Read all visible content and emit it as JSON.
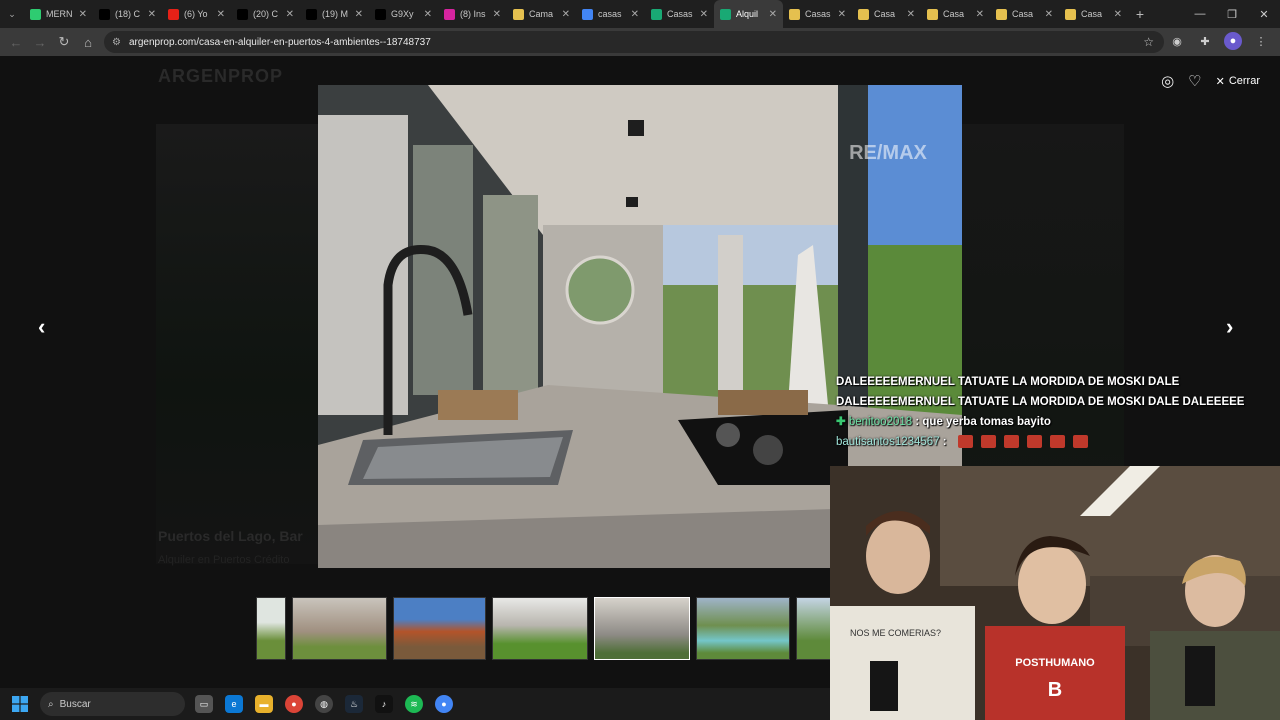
{
  "browser": {
    "tabs": [
      {
        "title": "MERN",
        "icon": "k-icon",
        "color": "#2ecc71"
      },
      {
        "title": "(18) C",
        "icon": "x-icon",
        "color": "#000000"
      },
      {
        "title": "(6) Yo",
        "icon": "youtube-icon",
        "color": "#e62117"
      },
      {
        "title": "(20) C",
        "icon": "x-icon",
        "color": "#000000"
      },
      {
        "title": "(19) M",
        "icon": "x-icon",
        "color": "#000000"
      },
      {
        "title": "G9Xy",
        "icon": "x-icon",
        "color": "#000000"
      },
      {
        "title": "(8) Ins",
        "icon": "instagram-icon",
        "color": "#d6249f"
      },
      {
        "title": "Cama",
        "icon": "listing-icon",
        "color": "#e5c04f"
      },
      {
        "title": "casas",
        "icon": "google-icon",
        "color": "#4285f4"
      },
      {
        "title": "Casas",
        "icon": "argenprop-icon",
        "color": "#19a974"
      },
      {
        "title": "Alquil",
        "icon": "argenprop-icon",
        "color": "#19a974",
        "active": true
      },
      {
        "title": "Casas",
        "icon": "listing-icon",
        "color": "#e5c04f"
      },
      {
        "title": "Casa",
        "icon": "listing-icon",
        "color": "#e5c04f"
      },
      {
        "title": "Casa",
        "icon": "listing-icon",
        "color": "#e5c04f"
      },
      {
        "title": "Casa",
        "icon": "listing-icon",
        "color": "#e5c04f"
      },
      {
        "title": "Casa",
        "icon": "listing-icon",
        "color": "#e5c04f"
      }
    ],
    "url": "argenprop.com/casa-en-alquiler-en-puertos-4-ambientes--18748737"
  },
  "page_bg": {
    "logo": "ARGENPROP",
    "title": "Puertos del Lago, Bar",
    "subtitle": "Alquiler en Puertos Crédito"
  },
  "gallery": {
    "close_label": "Cerrar",
    "watermark": "RE/MAX"
  },
  "chat": [
    {
      "user": "",
      "text": "DALEEEEEMERNUEL TATUATE LA MORDIDA DE MOSKI DALE"
    },
    {
      "user": "",
      "text": "DALEEEEEMERNUEL TATUATE LA MORDIDA DE MOSKI DALE DALEEEEE"
    },
    {
      "user": "benitoo2018",
      "text": "que yerba tomas bayito",
      "badge": true
    },
    {
      "user": "bautisantos1234567",
      "text": "",
      "emotes": 6
    }
  ],
  "webcam": {
    "shirt_text": "POSTHUMANO",
    "shirt_letter": "B",
    "shirt_left_text": "NOS ME COMERIAS?"
  },
  "taskbar": {
    "search_label": "Buscar"
  }
}
